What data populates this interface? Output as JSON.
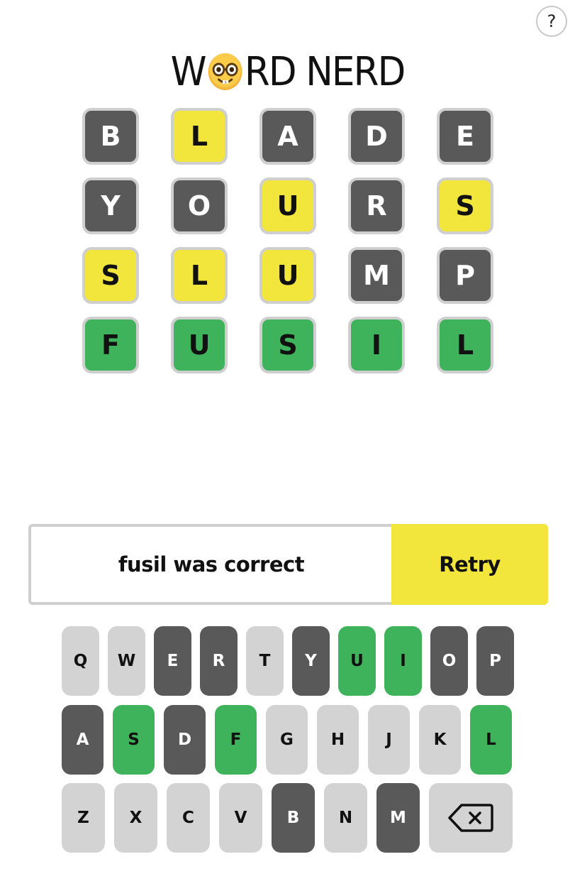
{
  "header": {
    "help_label": "?",
    "title_before": "W",
    "title_icon": "nerd-face-emoji",
    "title_after": "RD NERD"
  },
  "board": {
    "rows": [
      [
        {
          "letter": "B",
          "state": "absent"
        },
        {
          "letter": "L",
          "state": "present"
        },
        {
          "letter": "A",
          "state": "absent"
        },
        {
          "letter": "D",
          "state": "absent"
        },
        {
          "letter": "E",
          "state": "absent"
        }
      ],
      [
        {
          "letter": "Y",
          "state": "absent"
        },
        {
          "letter": "O",
          "state": "absent"
        },
        {
          "letter": "U",
          "state": "present"
        },
        {
          "letter": "R",
          "state": "absent"
        },
        {
          "letter": "S",
          "state": "present"
        }
      ],
      [
        {
          "letter": "S",
          "state": "present"
        },
        {
          "letter": "L",
          "state": "present"
        },
        {
          "letter": "U",
          "state": "present"
        },
        {
          "letter": "M",
          "state": "absent"
        },
        {
          "letter": "P",
          "state": "absent"
        }
      ],
      [
        {
          "letter": "F",
          "state": "correct"
        },
        {
          "letter": "U",
          "state": "correct"
        },
        {
          "letter": "S",
          "state": "correct"
        },
        {
          "letter": "I",
          "state": "correct"
        },
        {
          "letter": "L",
          "state": "correct"
        }
      ]
    ]
  },
  "result": {
    "message": "fusil was correct",
    "retry_label": "Retry"
  },
  "keyboard": {
    "rows": [
      [
        {
          "key": "Q",
          "state": "unused"
        },
        {
          "key": "W",
          "state": "unused"
        },
        {
          "key": "E",
          "state": "absent"
        },
        {
          "key": "R",
          "state": "absent"
        },
        {
          "key": "T",
          "state": "unused"
        },
        {
          "key": "Y",
          "state": "absent"
        },
        {
          "key": "U",
          "state": "correct"
        },
        {
          "key": "I",
          "state": "correct"
        },
        {
          "key": "O",
          "state": "absent"
        },
        {
          "key": "P",
          "state": "absent"
        }
      ],
      [
        {
          "key": "A",
          "state": "absent"
        },
        {
          "key": "S",
          "state": "correct"
        },
        {
          "key": "D",
          "state": "absent"
        },
        {
          "key": "F",
          "state": "correct"
        },
        {
          "key": "G",
          "state": "unused"
        },
        {
          "key": "H",
          "state": "unused"
        },
        {
          "key": "J",
          "state": "unused"
        },
        {
          "key": "K",
          "state": "unused"
        },
        {
          "key": "L",
          "state": "correct"
        }
      ],
      [
        {
          "key": "Z",
          "state": "unused"
        },
        {
          "key": "X",
          "state": "unused"
        },
        {
          "key": "C",
          "state": "unused"
        },
        {
          "key": "V",
          "state": "unused"
        },
        {
          "key": "B",
          "state": "absent"
        },
        {
          "key": "N",
          "state": "unused"
        },
        {
          "key": "M",
          "state": "absent"
        },
        {
          "key": "",
          "state": "unused",
          "icon": "backspace-icon"
        }
      ]
    ]
  },
  "colors": {
    "absent": "#595959",
    "present": "#f2e63d",
    "correct": "#3fb35b",
    "unused": "#d3d3d3",
    "tile_border": "#cfcfcf"
  }
}
